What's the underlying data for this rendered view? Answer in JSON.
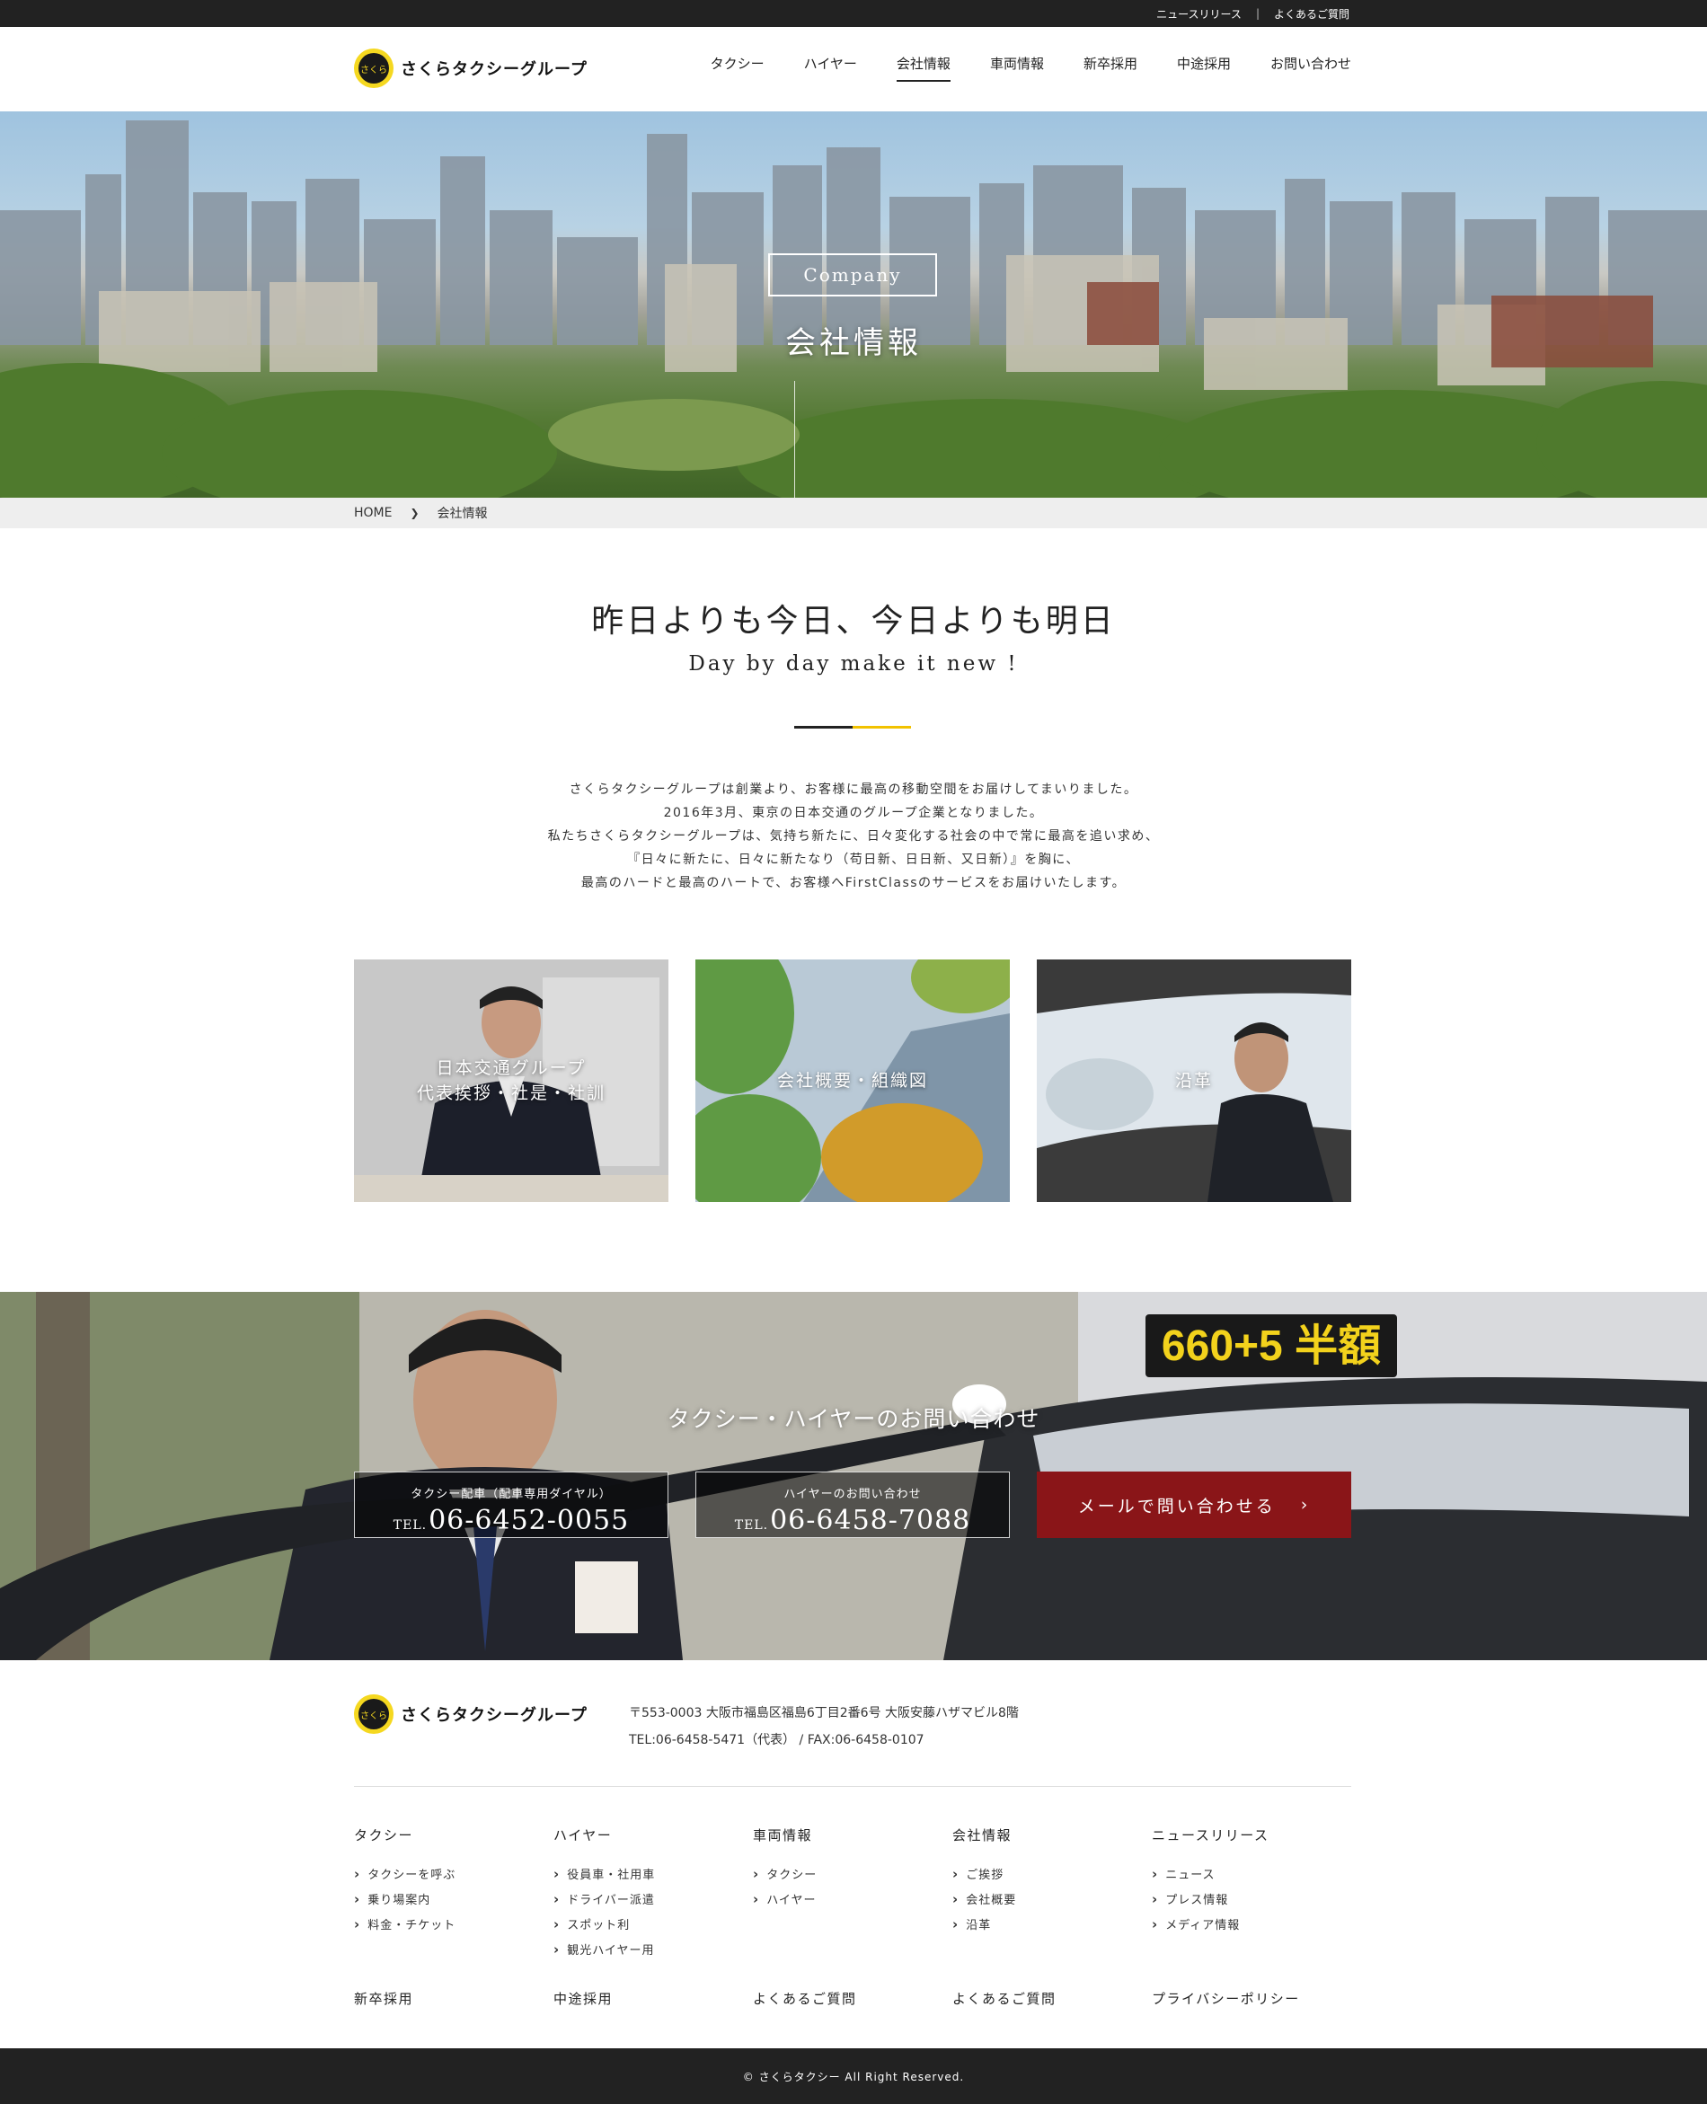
{
  "topbar": {
    "news": "ニュースリリース",
    "separator": "|",
    "faq": "よくあるご質問"
  },
  "brand": {
    "name": "さくらタクシーグループ",
    "mark": "さくら"
  },
  "nav": [
    {
      "label": "タクシー"
    },
    {
      "label": "ハイヤー"
    },
    {
      "label": "会社情報",
      "active": true
    },
    {
      "label": "車両情報"
    },
    {
      "label": "新卒採用"
    },
    {
      "label": "中途採用"
    },
    {
      "label": "お問い合わせ"
    }
  ],
  "hero": {
    "subtitle": "Company",
    "title": "会社情報"
  },
  "breadcrumb": {
    "home": "HOME",
    "current": "会社情報"
  },
  "intro": {
    "heading_jp": "昨日よりも今日、今日よりも明日",
    "heading_en": "Day by day make it new !",
    "lines": [
      "さくらタクシーグループは創業より、お客様に最高の移動空間をお届けしてまいりました。",
      "2016年3月、東京の日本交通のグループ企業となりました。",
      "私たちさくらタクシーグループは、気持ち新たに、日々変化する社会の中で常に最高を追い求め、",
      "『日々に新たに、日々に新たなり（苟日新、日日新、又日新）』を胸に、",
      "最高のハードと最高のハートで、お客様へFirstClassのサービスをお届けいたします。"
    ]
  },
  "cards": [
    {
      "label": "日本交通グループ\n代表挨拶・社是・社訓"
    },
    {
      "label": "会社概要・組織図"
    },
    {
      "label": "沿革"
    }
  ],
  "contact": {
    "title": "タクシー・ハイヤーのお問い合わせ",
    "taxi": {
      "caption": "タクシー配車（配車専用ダイヤル）",
      "prefix": "TEL.",
      "number": "06-6452-0055"
    },
    "hire": {
      "caption": "ハイヤーのお問い合わせ",
      "prefix": "TEL.",
      "number": "06-6458-7088"
    },
    "mail": {
      "label": "メールで問い合わせる",
      "arrow": "›"
    },
    "sign_text": "660+5 半額"
  },
  "footer": {
    "address": "〒553-0003 大阪市福島区福島6丁目2番6号 大阪安藤ハザマビル8階",
    "tel": "TEL:06-6458-5471（代表） / FAX:06-6458-0107",
    "columns": [
      {
        "heading": "タクシー",
        "items": [
          "タクシーを呼ぶ",
          "乗り場案内",
          "料金・チケット"
        ]
      },
      {
        "heading": "ハイヤー",
        "items": [
          "役員車・社用車",
          "ドライバー派遣",
          "スポット利",
          "観光ハイヤー用"
        ]
      },
      {
        "heading": "車両情報",
        "items": [
          "タクシー",
          "ハイヤー"
        ]
      },
      {
        "heading": "会社情報",
        "items": [
          "ご挨拶",
          "会社概要",
          "沿革"
        ]
      },
      {
        "heading": "ニュースリリース",
        "items": [
          "ニュース",
          "プレス情報",
          "メディア情報"
        ]
      }
    ],
    "bottom_links": [
      "新卒採用",
      "中途採用",
      "よくあるご質問",
      "よくあるご質問",
      "プライバシーポリシー"
    ],
    "copyright": "© さくらタクシー All Right Reserved."
  }
}
